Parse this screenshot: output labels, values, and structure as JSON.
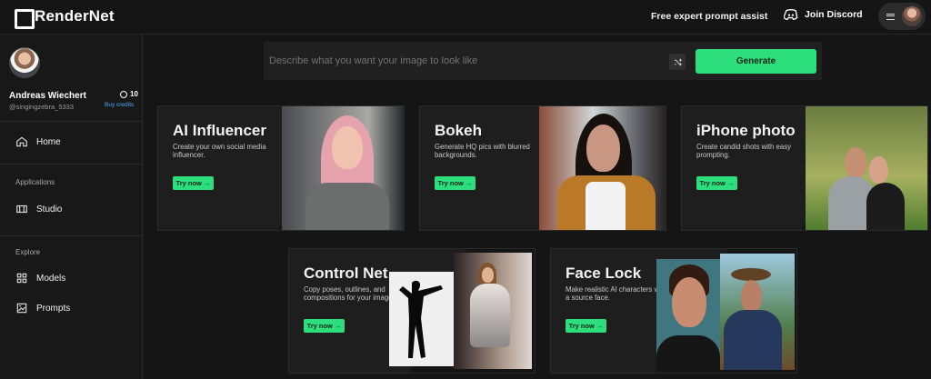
{
  "topbar": {
    "brand": "RenderNet",
    "prompt_assist": "Free expert prompt assist",
    "discord": "Join Discord"
  },
  "profile": {
    "name": "Andreas Wiechert",
    "handle": "@singingzebra_5333",
    "credits": "10",
    "buy_credits": "Buy credits"
  },
  "sidebar": {
    "home": "Home",
    "applications_label": "Applications",
    "studio": "Studio",
    "explore_label": "Explore",
    "models": "Models",
    "prompts": "Prompts"
  },
  "search": {
    "placeholder": "Describe what you want your image to look like",
    "generate": "Generate"
  },
  "cards": {
    "ai_influencer": {
      "title": "AI Influencer",
      "description": "Create your own social media influencer.",
      "button": "Try now →"
    },
    "bokeh": {
      "title": "Bokeh",
      "description": "Generate HQ pics with blurred backgrounds.",
      "button": "Try now →"
    },
    "iphone_photo": {
      "title": "iPhone photo",
      "description": "Create candid shots with easy prompting.",
      "button": "Try now →"
    },
    "control_net": {
      "title": "Control Net",
      "description": "Copy poses, outlines, and compositions for your images.",
      "button": "Try now →"
    },
    "face_lock": {
      "title": "Face Lock",
      "description": "Make realistic AI characters with a source face.",
      "button": "Try now →"
    }
  },
  "colors": {
    "background": "#151515",
    "accent": "#2ddf7c",
    "link": "#4aa8ff"
  },
  "icons": [
    "home-icon",
    "studio-icon",
    "models-icon",
    "prompts-icon",
    "discord-icon",
    "shuffle-icon",
    "menu-icon"
  ]
}
